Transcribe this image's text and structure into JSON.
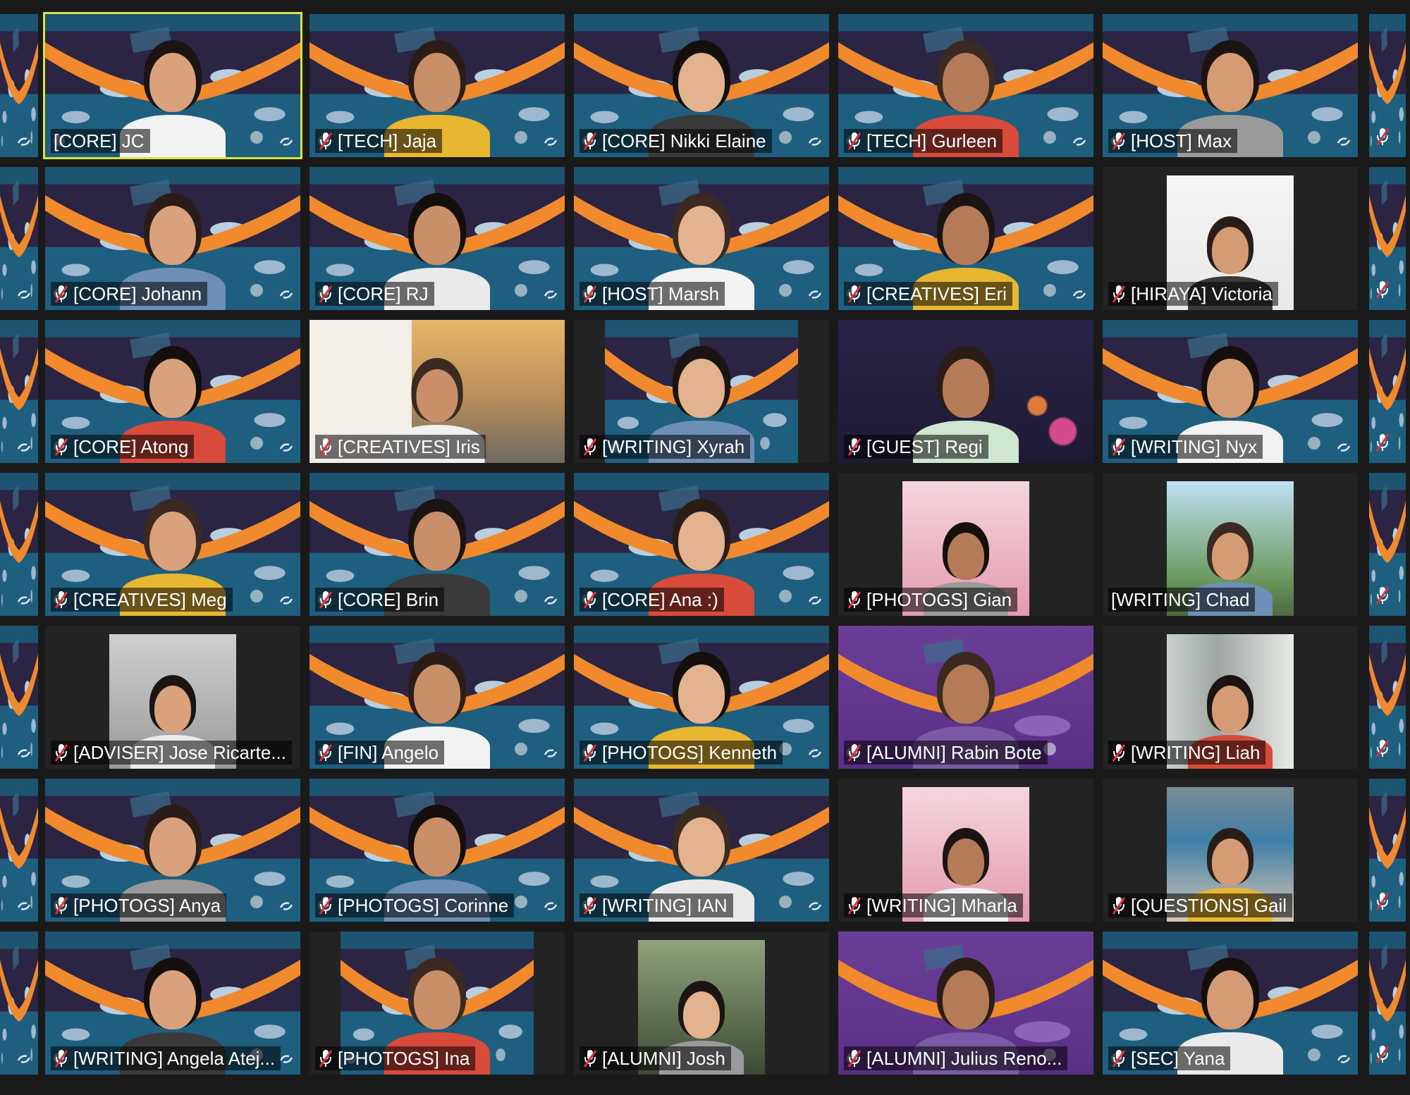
{
  "meeting": {
    "participants": [
      {
        "label": "[CORE] JC",
        "bg": "stage",
        "muted": false,
        "active": true
      },
      {
        "label": "[TECH] Jaja",
        "bg": "stage",
        "muted": true
      },
      {
        "label": "[CORE] Nikki Elaine",
        "bg": "stage",
        "muted": true
      },
      {
        "label": "[TECH] Gurleen",
        "bg": "stage",
        "muted": true
      },
      {
        "label": "[HOST] Max",
        "bg": "stage",
        "muted": true
      },
      {
        "label": "[CORE] Johann",
        "bg": "stage",
        "muted": true
      },
      {
        "label": "[CORE] RJ",
        "bg": "stage",
        "muted": true
      },
      {
        "label": "[HOST] Marsh",
        "bg": "stage",
        "muted": true
      },
      {
        "label": "[CREATIVES] Eri",
        "bg": "stage",
        "muted": true
      },
      {
        "label": "[HIRAYA] Victoria",
        "bg": "photo-white",
        "muted": true
      },
      {
        "label": "[CORE] Atong",
        "bg": "stage",
        "muted": true
      },
      {
        "label": "[CREATIVES] Iris",
        "bg": "uni",
        "muted": true
      },
      {
        "label": "[WRITING] Xyrah",
        "bg": "stage-inset",
        "muted": true
      },
      {
        "label": "[GUEST] Regi",
        "bg": "party",
        "muted": true
      },
      {
        "label": "[WRITING] Nyx",
        "bg": "stage",
        "muted": true
      },
      {
        "label": "[CREATIVES] Meg",
        "bg": "stage",
        "muted": true
      },
      {
        "label": "[CORE] Brin",
        "bg": "stage",
        "muted": true
      },
      {
        "label": "[CORE] Ana :)",
        "bg": "stage",
        "muted": true
      },
      {
        "label": "[PHOTOGS] Gian",
        "bg": "photo-pink",
        "muted": true
      },
      {
        "label": "[WRITING] Chad",
        "bg": "photo-sky",
        "muted": false
      },
      {
        "label": "[ADVISER] Jose Ricarte...",
        "bg": "photo-gray",
        "muted": true
      },
      {
        "label": "[FIN] Angelo",
        "bg": "stage",
        "muted": true
      },
      {
        "label": "[PHOTOGS] Kenneth",
        "bg": "stage",
        "muted": true
      },
      {
        "label": "[ALUMNI] Rabin Bote",
        "bg": "purple",
        "muted": true
      },
      {
        "label": "[WRITING] Liah",
        "bg": "photo-window",
        "muted": true
      },
      {
        "label": "[PHOTOGS] Anya",
        "bg": "stage",
        "muted": true
      },
      {
        "label": "[PHOTOGS] Corinne",
        "bg": "stage",
        "muted": true
      },
      {
        "label": "[WRITING] IAN",
        "bg": "stage",
        "muted": true
      },
      {
        "label": "[WRITING] Mharla",
        "bg": "photo-pink",
        "muted": true
      },
      {
        "label": "[QUESTIONS] Gail",
        "bg": "photo-pool",
        "muted": true
      },
      {
        "label": "[WRITING] Angela Atej...",
        "bg": "stage",
        "muted": true
      },
      {
        "label": "[PHOTOGS] Ina",
        "bg": "stage-inset",
        "muted": true
      },
      {
        "label": "[ALUMNI] Josh",
        "bg": "photo-street",
        "muted": true
      },
      {
        "label": "[ALUMNI] Julius Reno...",
        "bg": "purple",
        "muted": true
      },
      {
        "label": "[SEC] Yana",
        "bg": "stage",
        "muted": true
      }
    ]
  },
  "colors": {
    "active_speaker_border": "#d6e342",
    "muted_icon": "#e0303a",
    "swoosh": "#f08a2c",
    "gallery_bg": "#1a1a1a"
  },
  "icons": {
    "muted": "microphone-muted-icon",
    "sync": "background-sync-icon"
  }
}
